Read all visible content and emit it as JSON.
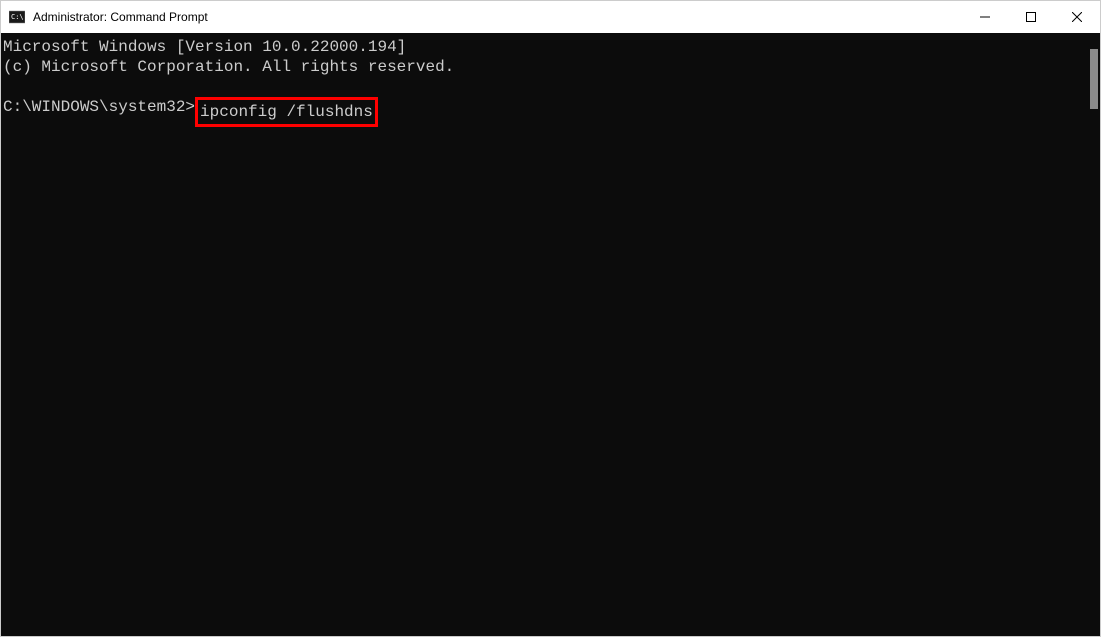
{
  "titleBar": {
    "title": "Administrator: Command Prompt"
  },
  "terminal": {
    "line1": "Microsoft Windows [Version 10.0.22000.194]",
    "line2": "(c) Microsoft Corporation. All rights reserved.",
    "promptPath": "C:\\WINDOWS\\system32>",
    "command": "ipconfig /flushdns"
  }
}
